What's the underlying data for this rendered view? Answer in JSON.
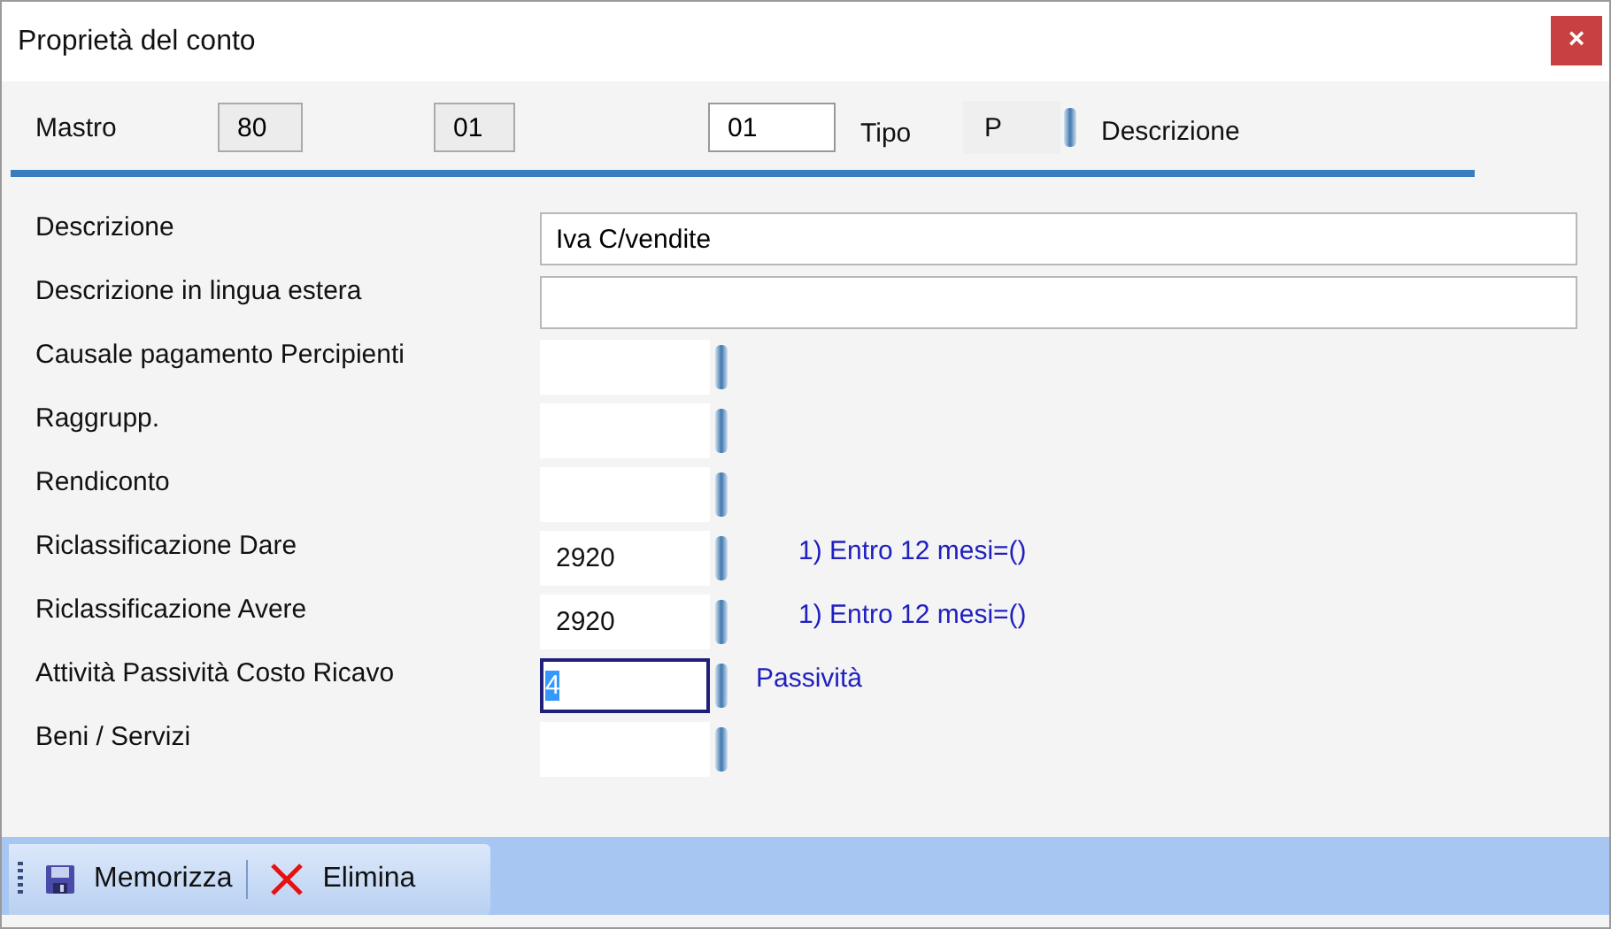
{
  "window": {
    "title": "Proprietà del conto",
    "close": "×"
  },
  "header": {
    "label": "Mastro",
    "fields": [
      {
        "value": "80",
        "readonly": true
      },
      {
        "value": "01",
        "readonly": true
      },
      {
        "value": "01",
        "readonly": false
      }
    ],
    "tipo_label": "Tipo",
    "tipo_value": "P",
    "descrizione_label": "Descrizione"
  },
  "rows": [
    {
      "label": "Descrizione",
      "kind": "text",
      "value": "Iva C/vendite"
    },
    {
      "label": "Descrizione in lingua estera",
      "kind": "text"
    },
    {
      "label": "Causale pagamento Percipienti",
      "kind": "code",
      "focused": false
    },
    {
      "label": "Raggrupp.",
      "kind": "code",
      "focused": false
    },
    {
      "label": "Rendiconto",
      "kind": "code",
      "focused": false
    },
    {
      "label": "Riclassificazione Dare",
      "kind": "code",
      "value": "2920",
      "note": "1) Entro 12 mesi=()",
      "focused": false
    },
    {
      "label": "Riclassificazione Avere",
      "kind": "code",
      "value": "2920",
      "note": "1) Entro 12 mesi=()",
      "focused": false
    },
    {
      "label": "Attività Passività Costo Ricavo",
      "kind": "code",
      "value": "4",
      "note": "Passività",
      "focused": true
    },
    {
      "label": "Beni / Servizi",
      "kind": "code",
      "focused": false
    }
  ],
  "toolbar": [
    {
      "label": "Memorizza",
      "kind": "save"
    },
    {
      "label": "Elimina",
      "kind": "delete"
    }
  ]
}
